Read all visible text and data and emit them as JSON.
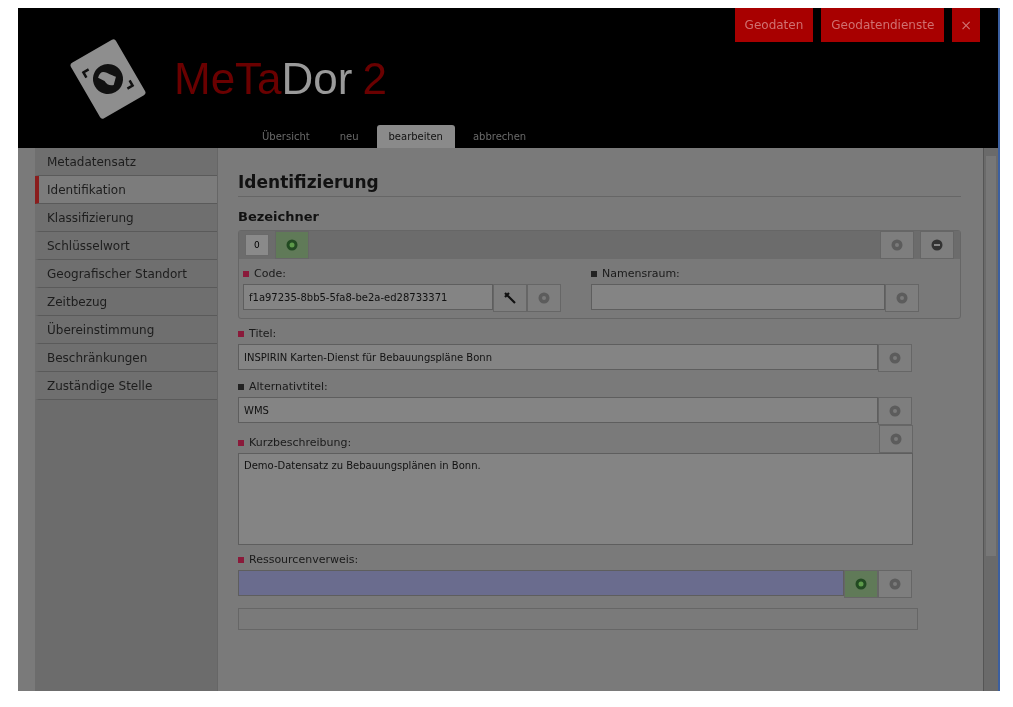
{
  "header": {
    "logo_parts": [
      {
        "text": "MeTa",
        "kind": "accent"
      },
      {
        "text": "Dor",
        "kind": "plain"
      },
      {
        "text": "2",
        "kind": "accent"
      }
    ],
    "top_buttons": [
      {
        "label": "Geodaten",
        "kind": "text"
      },
      {
        "label": "Geodatendienste",
        "kind": "text"
      },
      {
        "label": "×",
        "kind": "close"
      }
    ],
    "tabs": [
      {
        "label": "Übersicht",
        "selected": false
      },
      {
        "label": "neu",
        "selected": false
      },
      {
        "label": "bearbeiten",
        "selected": true
      },
      {
        "label": "abbrechen",
        "selected": false
      }
    ]
  },
  "sidebar": {
    "items": [
      {
        "label": "Metadatensatz",
        "selected": false
      },
      {
        "label": "Identifikation",
        "selected": true
      },
      {
        "label": "Klassifizierung",
        "selected": false
      },
      {
        "label": "Schlüsselwort",
        "selected": false
      },
      {
        "label": "Geografischer Standort",
        "selected": false
      },
      {
        "label": "Zeitbezug",
        "selected": false
      },
      {
        "label": "Übereinstimmung",
        "selected": false
      },
      {
        "label": "Beschränkungen",
        "selected": false
      },
      {
        "label": "Zuständige Stelle",
        "selected": false
      }
    ]
  },
  "main": {
    "heading": "Identifizierung",
    "subheading": "Bezeichner",
    "identifier_tabs": [
      {
        "label": "0",
        "selected": true
      }
    ],
    "code": {
      "label": "Code:",
      "required": true,
      "value": "f1a97235-8bb5-5fa8-be2a-ed28733371"
    },
    "namespace": {
      "label": "Namensraum:",
      "required": false
    },
    "fields": [
      {
        "kind": "text",
        "label": "Titel:",
        "required": true,
        "value": "INSPIRIN Karten-Dienst für Bebauungspläne Bonn"
      },
      {
        "kind": "text",
        "label": "Alternativtitel:",
        "required": false,
        "value": "WMS"
      },
      {
        "kind": "textarea",
        "label": "Kurzbeschreibung:",
        "required": true,
        "value": "Demo-Datensatz zu Bebauungsplänen in Bonn."
      },
      {
        "kind": "add",
        "label": "Ressourcenverweis:",
        "required": true
      }
    ]
  }
}
